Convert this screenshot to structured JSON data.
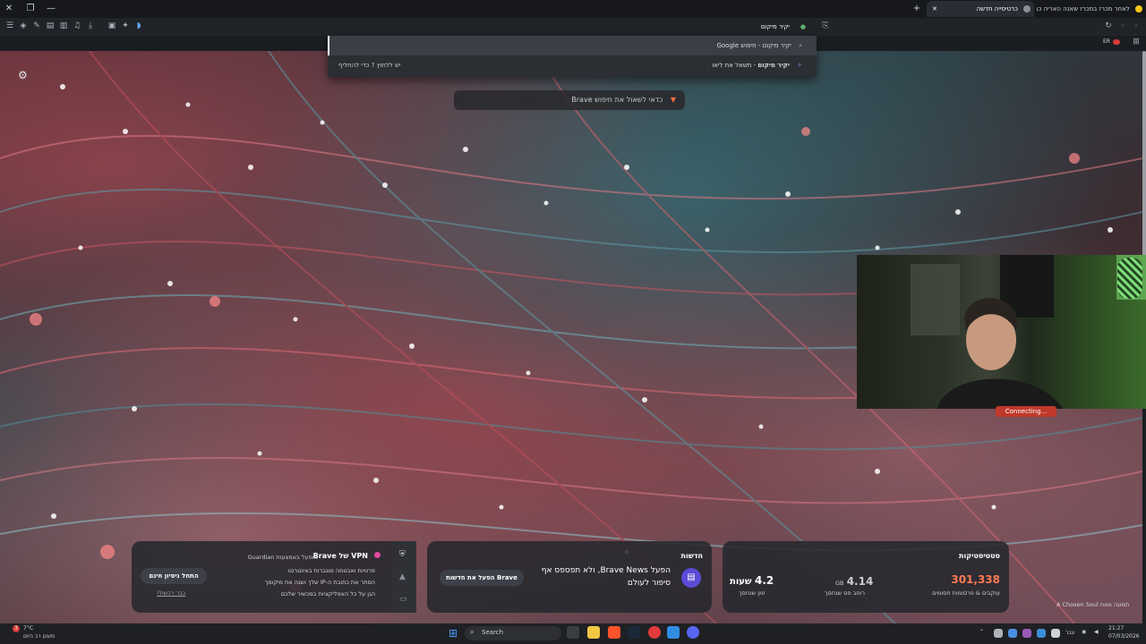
{
  "tabs": [
    {
      "label": "כרטיסייה חדשה",
      "active": true
    },
    {
      "label": "לאחר מכרז במכרז שאנה האריה כמה",
      "active": false
    }
  ],
  "toolbar": {
    "address_text": "יקיר מיקום",
    "icons": [
      "menu-icon",
      "shield-icon",
      "pen-icon",
      "sidebar-icon",
      "panel-icon",
      "music-icon",
      "download-icon",
      "screenshot-icon",
      "extensions-icon",
      "wallet-icon",
      "bookmark-icon",
      "reload-icon",
      "back-icon",
      "forward-icon"
    ]
  },
  "dropdown": {
    "rows": [
      {
        "query": "יקיר מיקום",
        "suffix": " - חיפוש Google",
        "hint": ""
      },
      {
        "query": "יקיר מיקום",
        "suffix": " - תשאל את ליאו",
        "hint": "יש ללחוץ ? כדי להחליף"
      }
    ]
  },
  "brave_tip": "כדאי לשאול את חיפוש Brave",
  "right_toolbar": {
    "lang": "ER"
  },
  "webcam": {
    "status": "Connecting..."
  },
  "cards": {
    "vpn": {
      "title": "VPN של Brave",
      "guardian": "מופעל באמצעות Guardian",
      "bullets": [
        "פרטיות ואבטחה מוגברות באינטרנט",
        "הסתר את כתובת ה-IP שלך ושנה את מיקומך",
        "הגן על כל האפליקציות במכשיר שלכם"
      ],
      "cta": "התחל ניסיון חינם",
      "link": "כבר רכשת?"
    },
    "news": {
      "title": "חדשות",
      "text_line1": "הפעל Brave News, ולא תפספס אף",
      "text_line2": "סיפור לעולם",
      "cta": "הפעל את חדשות Brave"
    },
    "stats": {
      "title": "סטטיסטיקות",
      "blocked_value": "301,338",
      "blocked_label": "עוקבים & פרסומות חסומים",
      "bandwidth_value": "4.14",
      "bandwidth_unit": "GB",
      "bandwidth_label": "רוחב פס שנחסך",
      "time_value": "4.2",
      "time_unit": "שעות",
      "time_label": "זמן שנחסך"
    }
  },
  "photo_credit": "תמונה מאת A Chosen Soul",
  "taskbar": {
    "weather_temp": "7°C",
    "weather_desc": "מעונן רב היום",
    "search_placeholder": "Search",
    "lang": "עבר",
    "time": "21:27",
    "date": "07/03/2026",
    "notification_count": "3"
  }
}
